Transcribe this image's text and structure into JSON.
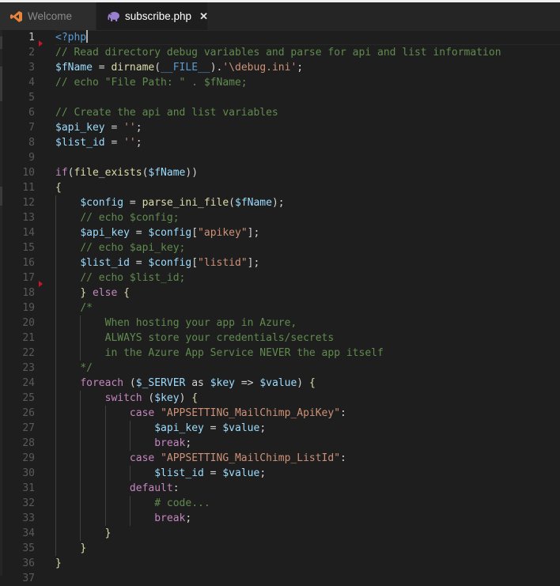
{
  "tabs": [
    {
      "label": "Welcome",
      "icon": "vscode-logo-icon",
      "active": false
    },
    {
      "label": "subscribe.php",
      "icon": "php-elephant-icon",
      "active": true,
      "close": "✕"
    }
  ],
  "colors": {
    "background": "#1e1e1e",
    "comment": "#608b4e",
    "variable": "#9cdcfe",
    "function": "#dcdcaa",
    "string": "#ce9178",
    "keyword": "#c586c0",
    "php_tag": "#569cd6",
    "breakpoint": "#c5162c"
  },
  "editor": {
    "cursor_line": 1,
    "breakpoint_lines": [
      2,
      18
    ],
    "lines": [
      {
        "n": "1",
        "tokens": [
          [
            "t-tag",
            "<?php"
          ]
        ]
      },
      {
        "n": "2",
        "tokens": [
          [
            "t-cm",
            "// Read directory debug variables and parse for api and list information"
          ]
        ]
      },
      {
        "n": "3",
        "tokens": [
          [
            "t-var",
            "$fName"
          ],
          [
            "t-op",
            " = "
          ],
          [
            "t-fn",
            "dirname"
          ],
          [
            "t-op",
            "("
          ],
          [
            "t-const",
            "__FILE__"
          ],
          [
            "t-op",
            ")."
          ],
          [
            "t-str",
            "'\\debug.ini'"
          ],
          [
            "t-op",
            ";"
          ]
        ]
      },
      {
        "n": "4",
        "tokens": [
          [
            "t-cm",
            "// echo \"File Path: \" . $fName;"
          ]
        ]
      },
      {
        "n": "5",
        "tokens": []
      },
      {
        "n": "6",
        "tokens": [
          [
            "t-cm",
            "// Create the api and list variables"
          ]
        ]
      },
      {
        "n": "7",
        "tokens": [
          [
            "t-var",
            "$api_key"
          ],
          [
            "t-op",
            " = "
          ],
          [
            "t-str",
            "''"
          ],
          [
            "t-op",
            ";"
          ]
        ]
      },
      {
        "n": "8",
        "tokens": [
          [
            "t-var",
            "$list_id"
          ],
          [
            "t-op",
            " = "
          ],
          [
            "t-str",
            "''"
          ],
          [
            "t-op",
            ";"
          ]
        ]
      },
      {
        "n": "9",
        "tokens": []
      },
      {
        "n": "10",
        "tokens": [
          [
            "t-kw",
            "if"
          ],
          [
            "t-op",
            "("
          ],
          [
            "t-fn",
            "file_exists"
          ],
          [
            "t-op",
            "("
          ],
          [
            "t-var",
            "$fName"
          ],
          [
            "t-op",
            "))"
          ]
        ]
      },
      {
        "n": "11",
        "tokens": [
          [
            "t-br",
            "{"
          ]
        ]
      },
      {
        "n": "12",
        "tokens": [
          [
            "t-op",
            "    "
          ],
          [
            "t-var",
            "$config"
          ],
          [
            "t-op",
            " = "
          ],
          [
            "t-fn",
            "parse_ini_file"
          ],
          [
            "t-op",
            "("
          ],
          [
            "t-var",
            "$fName"
          ],
          [
            "t-op",
            ");"
          ]
        ]
      },
      {
        "n": "13",
        "tokens": [
          [
            "t-op",
            "    "
          ],
          [
            "t-cm",
            "// echo $config;"
          ]
        ]
      },
      {
        "n": "14",
        "tokens": [
          [
            "t-op",
            "    "
          ],
          [
            "t-var",
            "$api_key"
          ],
          [
            "t-op",
            " = "
          ],
          [
            "t-var",
            "$config"
          ],
          [
            "t-op",
            "["
          ],
          [
            "t-str",
            "\"apikey\""
          ],
          [
            "t-op",
            "];"
          ]
        ]
      },
      {
        "n": "15",
        "tokens": [
          [
            "t-op",
            "    "
          ],
          [
            "t-cm",
            "// echo $api_key;"
          ]
        ]
      },
      {
        "n": "16",
        "tokens": [
          [
            "t-op",
            "    "
          ],
          [
            "t-var",
            "$list_id"
          ],
          [
            "t-op",
            " = "
          ],
          [
            "t-var",
            "$config"
          ],
          [
            "t-op",
            "["
          ],
          [
            "t-str",
            "\"listid\""
          ],
          [
            "t-op",
            "];"
          ]
        ]
      },
      {
        "n": "17",
        "tokens": [
          [
            "t-op",
            "    "
          ],
          [
            "t-cm",
            "// echo $list_id;"
          ]
        ]
      },
      {
        "n": "18",
        "tokens": [
          [
            "t-op",
            "    "
          ],
          [
            "t-br",
            "}"
          ],
          [
            "t-op",
            " "
          ],
          [
            "t-kw",
            "else"
          ],
          [
            "t-op",
            " "
          ],
          [
            "t-br",
            "{"
          ]
        ]
      },
      {
        "n": "19",
        "tokens": [
          [
            "t-op",
            "    "
          ],
          [
            "t-cm",
            "/*"
          ]
        ]
      },
      {
        "n": "20",
        "tokens": [
          [
            "t-op",
            "    "
          ],
          [
            "t-cm",
            "    When hosting your app in Azure,"
          ]
        ]
      },
      {
        "n": "21",
        "tokens": [
          [
            "t-op",
            "    "
          ],
          [
            "t-cm",
            "    ALWAYS store your credentials/secrets"
          ]
        ]
      },
      {
        "n": "22",
        "tokens": [
          [
            "t-op",
            "    "
          ],
          [
            "t-cm",
            "    in the Azure App Service NEVER the app itself"
          ]
        ]
      },
      {
        "n": "23",
        "tokens": [
          [
            "t-op",
            "    "
          ],
          [
            "t-cm",
            "*/"
          ]
        ]
      },
      {
        "n": "24",
        "tokens": [
          [
            "t-op",
            "    "
          ],
          [
            "t-kw",
            "foreach"
          ],
          [
            "t-op",
            " ("
          ],
          [
            "t-var",
            "$_SERVER"
          ],
          [
            "t-op",
            " as "
          ],
          [
            "t-var",
            "$key"
          ],
          [
            "t-op",
            " => "
          ],
          [
            "t-var",
            "$value"
          ],
          [
            "t-op",
            ") "
          ],
          [
            "t-br",
            "{"
          ]
        ]
      },
      {
        "n": "25",
        "tokens": [
          [
            "t-op",
            "        "
          ],
          [
            "t-kw",
            "switch"
          ],
          [
            "t-op",
            " ("
          ],
          [
            "t-var",
            "$key"
          ],
          [
            "t-op",
            ") "
          ],
          [
            "t-br",
            "{"
          ]
        ]
      },
      {
        "n": "26",
        "tokens": [
          [
            "t-op",
            "            "
          ],
          [
            "t-kw",
            "case"
          ],
          [
            "t-op",
            " "
          ],
          [
            "t-str",
            "\"APPSETTING_MailChimp_ApiKey\""
          ],
          [
            "t-op",
            ":"
          ]
        ]
      },
      {
        "n": "27",
        "tokens": [
          [
            "t-op",
            "                "
          ],
          [
            "t-var",
            "$api_key"
          ],
          [
            "t-op",
            " = "
          ],
          [
            "t-var",
            "$value"
          ],
          [
            "t-op",
            ";"
          ]
        ]
      },
      {
        "n": "28",
        "tokens": [
          [
            "t-op",
            "                "
          ],
          [
            "t-kw",
            "break"
          ],
          [
            "t-op",
            ";"
          ]
        ]
      },
      {
        "n": "29",
        "tokens": [
          [
            "t-op",
            "            "
          ],
          [
            "t-kw",
            "case"
          ],
          [
            "t-op",
            " "
          ],
          [
            "t-str",
            "\"APPSETTING_MailChimp_ListId\""
          ],
          [
            "t-op",
            ":"
          ]
        ]
      },
      {
        "n": "30",
        "tokens": [
          [
            "t-op",
            "                "
          ],
          [
            "t-var",
            "$list_id"
          ],
          [
            "t-op",
            " = "
          ],
          [
            "t-var",
            "$value"
          ],
          [
            "t-op",
            ";"
          ]
        ]
      },
      {
        "n": "31",
        "tokens": [
          [
            "t-op",
            "            "
          ],
          [
            "t-kw",
            "default"
          ],
          [
            "t-op",
            ":"
          ]
        ]
      },
      {
        "n": "32",
        "tokens": [
          [
            "t-op",
            "                "
          ],
          [
            "t-cm",
            "# code..."
          ]
        ]
      },
      {
        "n": "33",
        "tokens": [
          [
            "t-op",
            "                "
          ],
          [
            "t-kw",
            "break"
          ],
          [
            "t-op",
            ";"
          ]
        ]
      },
      {
        "n": "34",
        "tokens": [
          [
            "t-op",
            "        "
          ],
          [
            "t-br",
            "}"
          ]
        ]
      },
      {
        "n": "35",
        "tokens": [
          [
            "t-op",
            "    "
          ],
          [
            "t-br",
            "}"
          ]
        ]
      },
      {
        "n": "36",
        "tokens": [
          [
            "t-br",
            "}"
          ]
        ]
      },
      {
        "n": "37",
        "tokens": []
      }
    ]
  }
}
